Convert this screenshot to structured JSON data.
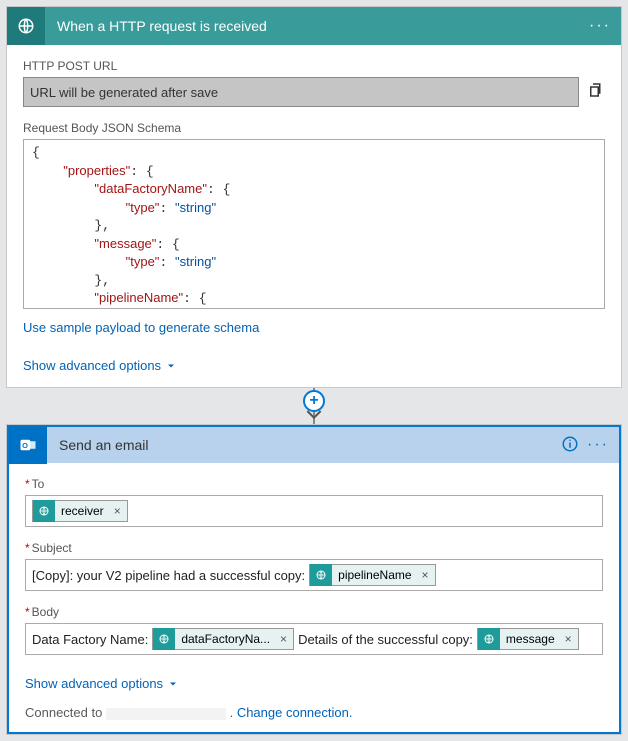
{
  "trigger": {
    "title": "When a HTTP request is received",
    "url_label": "HTTP POST URL",
    "url_placeholder": "URL will be generated after save",
    "schema_label": "Request Body JSON Schema",
    "sample_link": "Use sample payload to generate schema",
    "advanced_link": "Show advanced options",
    "schema_tokens": [
      {
        "t": "plain",
        "v": "{"
      },
      {
        "t": "nl"
      },
      {
        "t": "indent",
        "n": 2
      },
      {
        "t": "key",
        "v": "\"properties\""
      },
      {
        "t": "plain",
        "v": ": {"
      },
      {
        "t": "nl"
      },
      {
        "t": "indent",
        "n": 4
      },
      {
        "t": "key",
        "v": "\"dataFactoryName\""
      },
      {
        "t": "plain",
        "v": ": {"
      },
      {
        "t": "nl"
      },
      {
        "t": "indent",
        "n": 6
      },
      {
        "t": "key",
        "v": "\"type\""
      },
      {
        "t": "plain",
        "v": ": "
      },
      {
        "t": "str",
        "v": "\"string\""
      },
      {
        "t": "nl"
      },
      {
        "t": "indent",
        "n": 4
      },
      {
        "t": "plain",
        "v": "},"
      },
      {
        "t": "nl"
      },
      {
        "t": "indent",
        "n": 4
      },
      {
        "t": "key",
        "v": "\"message\""
      },
      {
        "t": "plain",
        "v": ": {"
      },
      {
        "t": "nl"
      },
      {
        "t": "indent",
        "n": 6
      },
      {
        "t": "key",
        "v": "\"type\""
      },
      {
        "t": "plain",
        "v": ": "
      },
      {
        "t": "str",
        "v": "\"string\""
      },
      {
        "t": "nl"
      },
      {
        "t": "indent",
        "n": 4
      },
      {
        "t": "plain",
        "v": "},"
      },
      {
        "t": "nl"
      },
      {
        "t": "indent",
        "n": 4
      },
      {
        "t": "key",
        "v": "\"pipelineName\""
      },
      {
        "t": "plain",
        "v": ": {"
      },
      {
        "t": "nl"
      },
      {
        "t": "indent",
        "n": 6
      },
      {
        "t": "key",
        "v": "\"type\""
      },
      {
        "t": "plain",
        "v": ": "
      },
      {
        "t": "str",
        "v": "\"string\""
      }
    ]
  },
  "action": {
    "title": "Send an email",
    "to_label": "To",
    "subject_label": "Subject",
    "body_label": "Body",
    "subject_prefix": "[Copy]: your V2 pipeline had a successful copy:",
    "body_text1": "Data Factory Name:",
    "body_text2": "Details of the successful copy:",
    "advanced_link": "Show advanced options",
    "connected_label": "Connected to",
    "change_link": "Change connection.",
    "tokens": {
      "receiver": "receiver",
      "pipelineName": "pipelineName",
      "dataFactoryName": "dataFactoryNa...",
      "message": "message"
    }
  }
}
